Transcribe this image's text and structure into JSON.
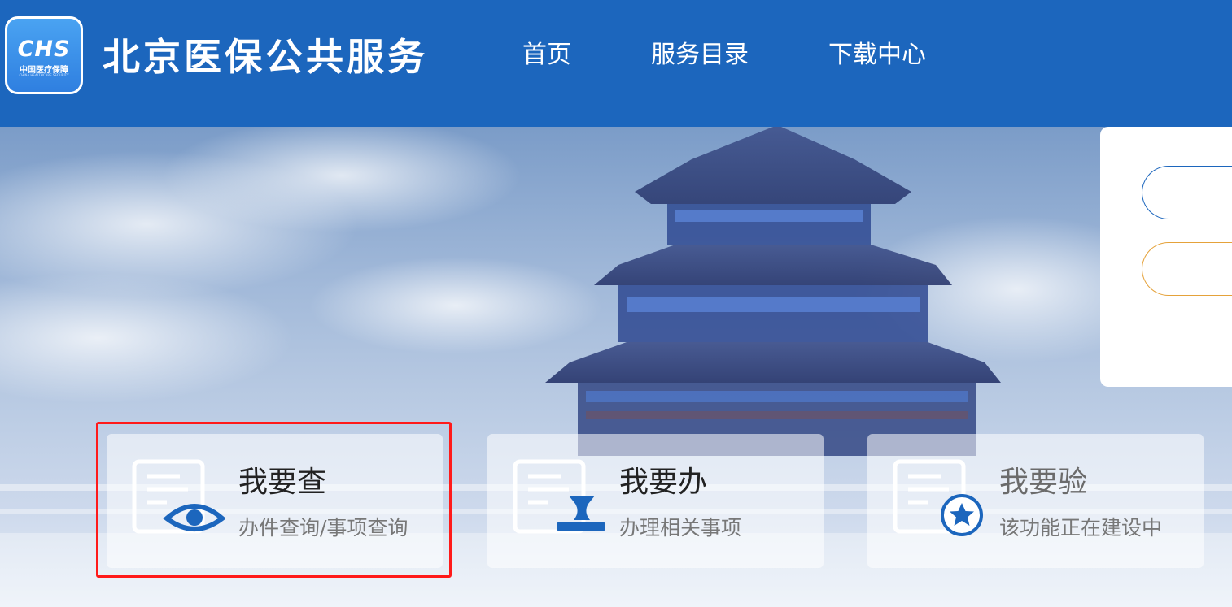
{
  "header": {
    "logo": {
      "mark": "CHS",
      "cn": "中国医疗保障",
      "en": "CHINA HEALTHCARE SECURITY"
    },
    "title": "北京医保公共服务",
    "nav": [
      "首页",
      "服务目录",
      "下载中心"
    ]
  },
  "cards": [
    {
      "title": "我要查",
      "subtitle": "办件查询/事项查询",
      "icon": "document-eye-icon"
    },
    {
      "title": "我要办",
      "subtitle": "办理相关事项",
      "icon": "document-stamp-icon"
    },
    {
      "title": "我要验",
      "subtitle": "该功能正在建设中",
      "icon": "document-star-icon"
    }
  ],
  "colors": {
    "brand": "#1c66bd",
    "highlight": "#ff1a1a",
    "accent_orange": "#e5a23a"
  }
}
